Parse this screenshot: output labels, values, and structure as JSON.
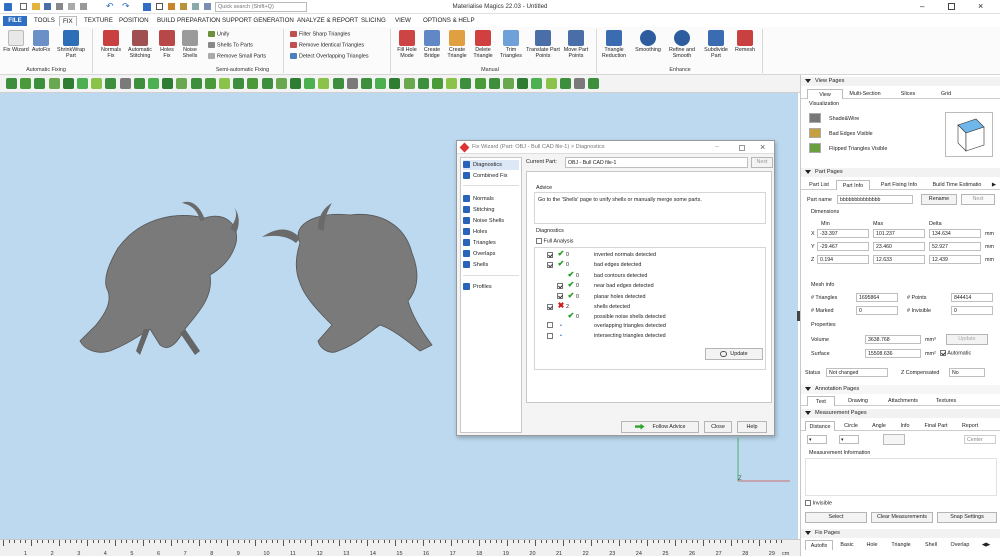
{
  "app": {
    "title": "Materialise Magics 22.03 - Untitled",
    "search_placeholder": "Quick search (Shift+Q)"
  },
  "menu": [
    "FILE",
    "TOOLS",
    "FIX",
    "TEXTURE",
    "POSITION",
    "BUILD PREPARATION",
    "SUPPORT GENERATION",
    "ANALYZE & REPORT",
    "SLICING",
    "VIEW",
    "OPTIONS & HELP"
  ],
  "ribbon": {
    "auto_fixing": {
      "label": "Automatic Fixing",
      "items": [
        "Fix Wizard",
        "AutoFix",
        "ShrinkWrap Part"
      ]
    },
    "semi": {
      "label": "Semi-automatic Fixing",
      "items": [
        "Normals Fix",
        "Automatic Stitching",
        "Holes Fix",
        "Noise Shells"
      ],
      "small": [
        "Unify",
        "Shells To Parts",
        "Remove Small Parts"
      ]
    },
    "filters": [
      "Filter Sharp Triangles",
      "Remove Identical Triangles",
      "Detect Overlapping Triangles"
    ],
    "manual": {
      "label": "Manual",
      "items": [
        "Fill Hole Mode",
        "Create Bridge",
        "Create Triangle",
        "Delete Triangle",
        "Trim Triangles",
        "Translate Part Points",
        "Move Part Points"
      ]
    },
    "enhance": {
      "label": "Enhance",
      "items": [
        "Triangle Reduction",
        "Smoothing",
        "Refine and Smooth",
        "Subdivide Part",
        "Remesh"
      ]
    }
  },
  "dialog": {
    "title": "Fix Wizard (Part: OBJ - Bull CAD file-1) > Diagnostics",
    "nav_top": [
      "Diagnostics",
      "Combined Fix"
    ],
    "nav_mid": [
      "Normals",
      "Stitching",
      "Noise Shells",
      "Holes",
      "Triangles",
      "Overlaps",
      "Shells"
    ],
    "nav_bottom": [
      "Profiles"
    ],
    "current_part_label": "Current Part:",
    "current_part_value": "OBJ - Bull CAD file-1",
    "next": "Next",
    "advice_label": "Advice",
    "advice_text": "Go to the 'Shells' page to unify shells or manually merge some parts.",
    "diag_label": "Diagnostics",
    "full_analysis": "Full Analysis",
    "rows": [
      {
        "checked": true,
        "mark": "ok",
        "count": "0",
        "label": "inverted normals detected",
        "indent": 0
      },
      {
        "checked": true,
        "mark": "ok",
        "count": "0",
        "label": "bad edges detected",
        "indent": 0
      },
      {
        "checked": false,
        "mark": "ok",
        "count": "0",
        "label": "bad contours detected",
        "indent": 1
      },
      {
        "checked": true,
        "mark": "ok",
        "count": "0",
        "label": "near bad edges detected",
        "indent": 1
      },
      {
        "checked": true,
        "mark": "ok",
        "count": "0",
        "label": "planar holes detected",
        "indent": 1
      },
      {
        "checked": true,
        "mark": "bad",
        "count": "2",
        "label": "shells detected",
        "indent": 0
      },
      {
        "checked": false,
        "mark": "ok",
        "count": "0",
        "label": "possible noise shells detected",
        "indent": 1
      },
      {
        "checked": false,
        "mark": "dot",
        "count": "",
        "label": "overlapping triangles detected",
        "indent": 0
      },
      {
        "checked": false,
        "mark": "dot",
        "count": "",
        "label": "intersecting triangles detected",
        "indent": 0
      }
    ],
    "update": "Update",
    "follow_advice": "Follow Advice",
    "close": "Close",
    "help": "Help"
  },
  "panel": {
    "view_pages": "View Pages",
    "view_tabs": [
      "View",
      "Multi-Section",
      "Slices",
      "Grid"
    ],
    "visualization": "Visualization",
    "vis_items": [
      "Shade&Wire",
      "Bad Edges Visible",
      "Flipped Triangles Visible"
    ],
    "part_pages": "Part Pages",
    "part_tabs": [
      "Part List",
      "Part Info",
      "Part Fixing Info",
      "Build Time Estimatio"
    ],
    "part_name_label": "Part name",
    "part_name": "bbbbbbbbbbbbbb",
    "rename": "Rename",
    "next": "Next",
    "dimensions": "Dimensions",
    "dim_headers": [
      "Min",
      "Max",
      "Delta"
    ],
    "dims": [
      {
        "axis": "X",
        "min": "-33.397",
        "max": "101.237",
        "delta": "134.634",
        "unit": "mm"
      },
      {
        "axis": "Y",
        "min": "-29.467",
        "max": "23.460",
        "delta": "52.927",
        "unit": "mm"
      },
      {
        "axis": "Z",
        "min": "0.194",
        "max": "12.633",
        "delta": "12.439",
        "unit": "mm"
      }
    ],
    "mesh_info": "Mesh info",
    "triangles_label": "# Triangles",
    "triangles": "1695864",
    "points_label": "# Points",
    "points": "844414",
    "marked_label": "# Marked",
    "marked": "0",
    "invisible_label": "# Invisible",
    "invisible": "0",
    "properties": "Properties",
    "volume_label": "Volume",
    "volume": "3638.768",
    "volume_unit": "mm³",
    "surface_label": "Surface",
    "surface": "15508.636",
    "surface_unit": "mm²",
    "update": "Update",
    "automatic": "Automatic",
    "status_label": "Status",
    "status": "Not changed",
    "zcomp_label": "Z Compensated",
    "zcomp": "No",
    "annotation_pages": "Annotation Pages",
    "ann_tabs": [
      "Text",
      "Drawing",
      "Attachments",
      "Textures"
    ],
    "measurement_pages": "Measurement Pages",
    "meas_tabs": [
      "Distance",
      "Circle",
      "Angle",
      "Info",
      "Final Part",
      "Report"
    ],
    "center": "Center",
    "meas_info": "Measurement Information",
    "invisible_chk": "Invisible",
    "select": "Select",
    "clear": "Clear Measurements",
    "snap": "Snap Settings",
    "fix_pages": "Fix Pages",
    "fix_tabs": [
      "Autofix",
      "Basic",
      "Hole",
      "Triangle",
      "Shell",
      "Overlap"
    ]
  },
  "ruler": [
    "1",
    "2",
    "3",
    "4",
    "5",
    "6",
    "7",
    "8",
    "9",
    "10",
    "11",
    "12",
    "13",
    "14",
    "15",
    "16",
    "17",
    "18",
    "19",
    "20",
    "21",
    "22",
    "23",
    "24",
    "25",
    "26",
    "27",
    "28",
    "29"
  ],
  "ruler_unit": "cm",
  "axis_label": "Z",
  "colors": {
    "accent": "#2f6fc3",
    "viewport": "#bcd9ef",
    "ok": "#1e9b1e",
    "bad": "#d01818"
  }
}
